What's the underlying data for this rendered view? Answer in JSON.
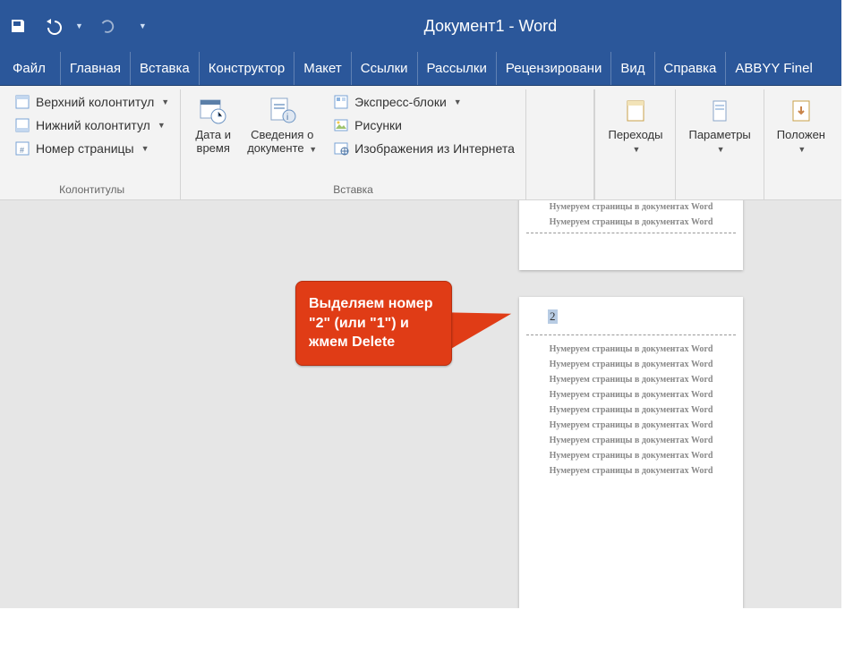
{
  "titlebar": {
    "doc_name": "Документ1",
    "sep": " - ",
    "app_name": "Word"
  },
  "tabs": {
    "file": "Файл",
    "home": "Главная",
    "insert": "Вставка",
    "design": "Конструктор",
    "layout": "Макет",
    "references": "Ссылки",
    "mailings": "Рассылки",
    "review": "Рецензировани",
    "view": "Вид",
    "help": "Справка",
    "abbyy": "ABBYY Finel"
  },
  "ribbon": {
    "hf_group": {
      "label": "Колонтитулы",
      "header": "Верхний колонтитул",
      "footer": "Нижний колонтитул",
      "pagenum": "Номер страницы"
    },
    "insert_group": {
      "label": "Вставка",
      "datetime_l1": "Дата и",
      "datetime_l2": "время",
      "docinfo_l1": "Сведения о",
      "docinfo_l2": "документе",
      "quickparts": "Экспресс-блоки",
      "pictures": "Рисунки",
      "online_pics": "Изображения из Интернета"
    },
    "nav": {
      "label": "Переходы"
    },
    "opts": {
      "label": "Параметры"
    },
    "pos": {
      "label": "Положен"
    }
  },
  "doc": {
    "para": "Нумеруем страницы в документах Word",
    "pagenum": "2"
  },
  "callout": {
    "text": "Выделяем номер \"2\" (или \"1\") и жмем Delete"
  }
}
